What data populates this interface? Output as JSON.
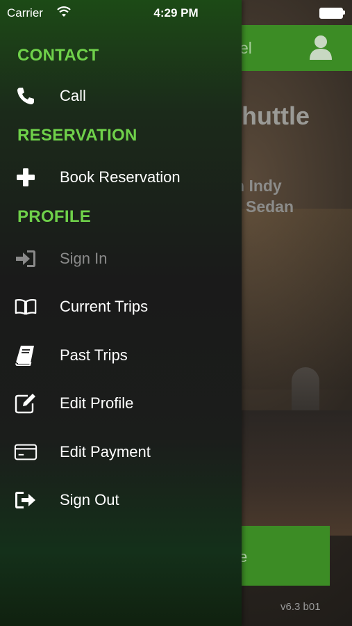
{
  "status_bar": {
    "carrier": "Carrier",
    "time": "4:29 PM"
  },
  "background": {
    "header_title": "el",
    "title": "huttle",
    "subtitle_line1": "n Indy",
    "subtitle_line2": "Sedan",
    "button_label": "e",
    "version": "v6.3  b01"
  },
  "drawer": {
    "sections": {
      "contact": "CONTACT",
      "reservation": "RESERVATION",
      "profile": "PROFILE"
    },
    "items": {
      "call": "Call",
      "book_reservation": "Book Reservation",
      "sign_in": "Sign In",
      "current_trips": "Current Trips",
      "past_trips": "Past Trips",
      "edit_profile": "Edit Profile",
      "edit_payment": "Edit Payment",
      "sign_out": "Sign Out"
    }
  },
  "colors": {
    "accent_green": "#3c8c25",
    "section_green": "#6fd14a"
  }
}
